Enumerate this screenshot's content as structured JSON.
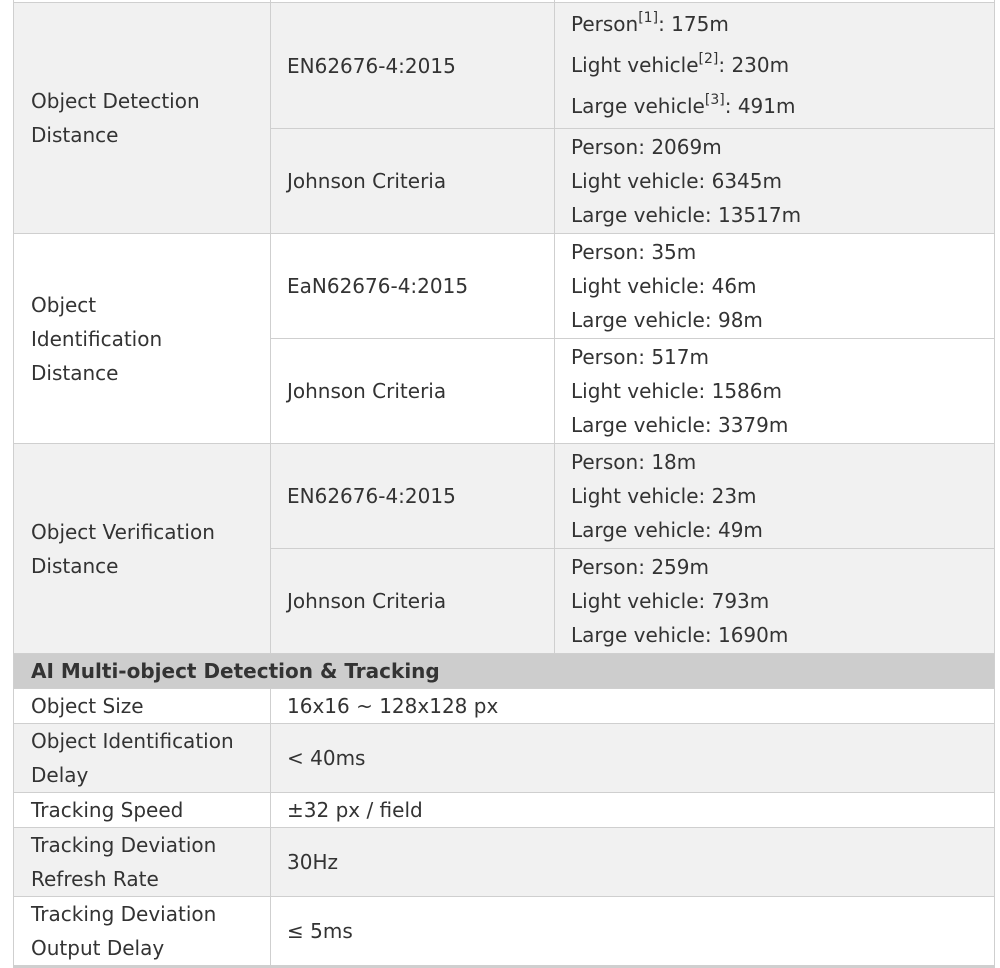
{
  "range_rows": [
    {
      "group": "Object Detection Distance",
      "shade": true,
      "standards": [
        {
          "name": "EN62676-4:2015",
          "values": [
            {
              "label": "Person",
              "ref": "[1]",
              "value": "175m"
            },
            {
              "label": "Light vehicle",
              "ref": "[2]",
              "value": "230m"
            },
            {
              "label": "Large vehicle",
              "ref": "[3]",
              "value": "491m"
            }
          ]
        },
        {
          "name": "Johnson Criteria",
          "values": [
            {
              "label": "Person",
              "value": "2069m"
            },
            {
              "label": "Light vehicle",
              "value": "6345m"
            },
            {
              "label": "Large vehicle",
              "value": "13517m"
            }
          ]
        }
      ]
    },
    {
      "group": "Object Identification Distance",
      "shade": false,
      "standards": [
        {
          "name": "EaN62676-4:2015",
          "values": [
            {
              "label": "Person",
              "value": "35m"
            },
            {
              "label": "Light vehicle",
              "value": "46m"
            },
            {
              "label": "Large vehicle",
              "value": "98m"
            }
          ]
        },
        {
          "name": "Johnson Criteria",
          "values": [
            {
              "label": "Person",
              "value": "517m"
            },
            {
              "label": "Light vehicle",
              "value": "1586m"
            },
            {
              "label": "Large vehicle",
              "value": "3379m"
            }
          ]
        }
      ]
    },
    {
      "group": "Object Verification Distance",
      "shade": true,
      "standards": [
        {
          "name": "EN62676-4:2015",
          "values": [
            {
              "label": "Person",
              "value": "18m"
            },
            {
              "label": "Light vehicle",
              "value": "23m"
            },
            {
              "label": "Large vehicle",
              "value": "49m"
            }
          ]
        },
        {
          "name": "Johnson Criteria",
          "values": [
            {
              "label": "Person",
              "value": "259m"
            },
            {
              "label": "Light vehicle",
              "value": "793m"
            },
            {
              "label": "Large vehicle",
              "value": "1690m"
            }
          ]
        }
      ]
    }
  ],
  "section": {
    "title": "AI Multi-object Detection & Tracking"
  },
  "spec_rows": [
    {
      "label": "Object Size",
      "value": "16x16 ~ 128x128 px",
      "shade": false
    },
    {
      "label": "Object Identification Delay",
      "value": "< 40ms",
      "shade": true
    },
    {
      "label": "Tracking Speed",
      "value": "±32 px / field",
      "shade": false
    },
    {
      "label": "Tracking Deviation Refresh Rate",
      "value": "30Hz",
      "shade": true
    },
    {
      "label": "Tracking Deviation Output Delay",
      "value": "≤ 5ms",
      "shade": false
    }
  ],
  "separator": ": "
}
